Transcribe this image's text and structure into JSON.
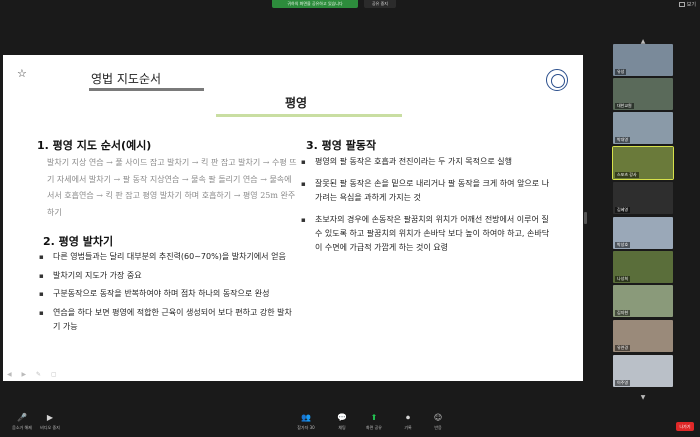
{
  "topbar": {
    "share_banner": "귀하의 화면을 공유하고 있습니다",
    "stop_share": "공유 중지",
    "view_options": "보기"
  },
  "slide": {
    "logo": "☆",
    "title": "영법 지도순서",
    "subtitle": "평영",
    "left": {
      "heading1": "1. 평영 지도 순서(예시)",
      "para": "발차기 지상 연습 → 풀 사이드 잡고 발차기 → 킥 판 잡고 발차기 → 수평 뜨기 자세에서 발차기 → 팔 동작 지상연습 → 물속 팔 돌리기 연습 → 물속에 서서 호흡연습 → 킥 판 잡고 평영 발차기 하며 호흡하기 → 평영 25m 완주하기",
      "heading2": "2. 평영 발차기",
      "items": [
        "다른 영법들과는 달리 대부분의 추진력(60~70%)을 발차기에서 얻음",
        "발차기의 지도가 가장 중요",
        "구분동작으로 동작을 반복하여야 하며 점차 하나의 동작으로 완성",
        "연습을 하다 보면 평영에 적합한 근육이 생성되어 보다 편하고 강한 발차기 가능"
      ]
    },
    "right": {
      "heading": "3. 평영 팔동작",
      "items": [
        "평영의 팔 동작은 호흡과 전진이라는 두 가지 목적으로 실행",
        "잘못된 팔 동작은 손을 밑으로 내리거나 팔 동작을 크게 하여 앞으로 나가려는 욕심을 과하게 가지는 것",
        "초보자의 경우에 손동작은 팔꿈치의 위치가 어깨선 전방에서 이루어 질 수 있도록 하고 팔꿈치의 위치가 손바닥 보다 높이 하여야 하고, 손바닥이 수면에 가급적 가깝게 하는 것이 요령"
      ]
    },
    "controls": "◀ ▶ ✎ ▢"
  },
  "participants": [
    {
      "name": "유성",
      "bg": "#7a8a9a"
    },
    {
      "name": "대한교원",
      "bg": "#5a6a5a"
    },
    {
      "name": "박대영",
      "bg": "#8a9aa8"
    },
    {
      "name": "스포츠 강사",
      "bg": "#6a7a3a"
    },
    {
      "name": "김혜영",
      "bg": "#2e2e2e"
    },
    {
      "name": "박성호",
      "bg": "#9aa8b8"
    },
    {
      "name": "나성희",
      "bg": "#5a6e3a"
    },
    {
      "name": "김지현",
      "bg": "#8a9a7a"
    },
    {
      "name": "유연경",
      "bg": "#9a8a7a"
    },
    {
      "name": "이주영",
      "bg": "#bac0c8"
    }
  ],
  "toolbar": {
    "mute": "음소거 해제",
    "video": "비디오 중지",
    "participants": "참가자",
    "participants_count": "30",
    "chat": "채팅",
    "share": "화면 공유",
    "record": "기록",
    "reactions": "반응",
    "end": "나가기"
  }
}
